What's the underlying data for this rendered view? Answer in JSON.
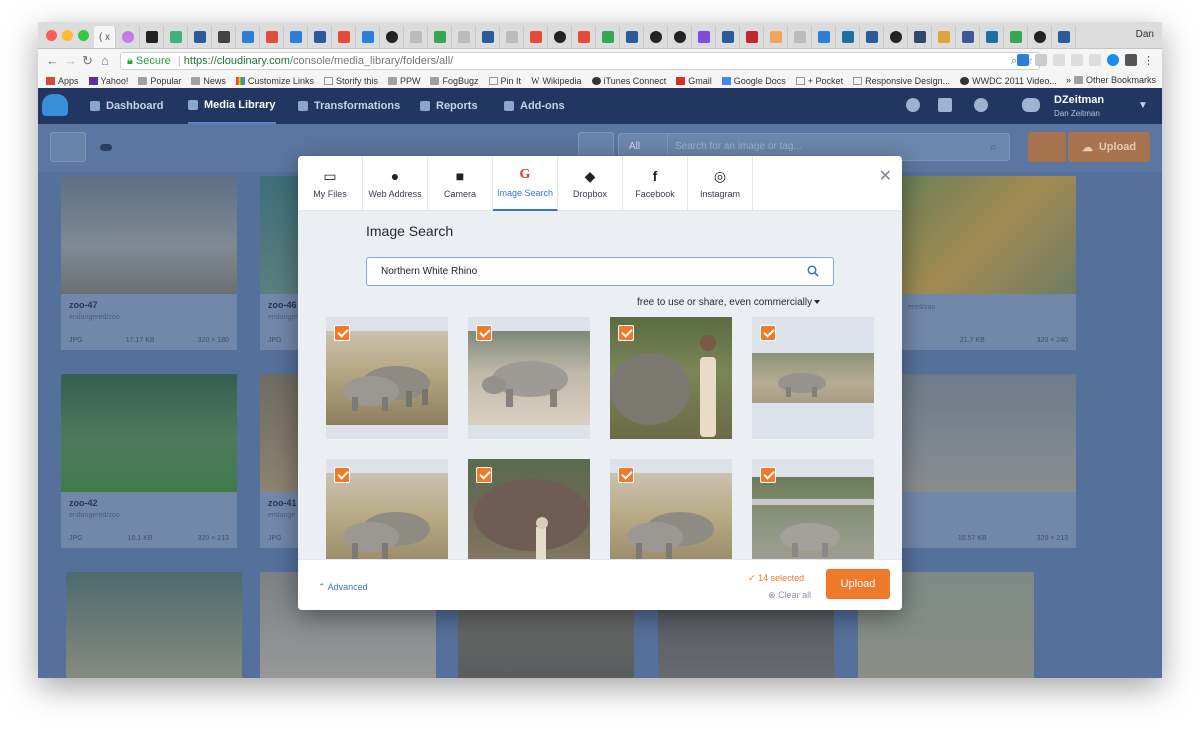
{
  "browser": {
    "profile_name": "Dan",
    "active_tab_label": "( x",
    "secure_label": "Secure",
    "url_base": "https://cloudinary.com",
    "url_path": "/console/media_library/folders/all/"
  },
  "bookmarks": {
    "items": [
      "Apps",
      "Yahoo!",
      "Popular",
      "News",
      "Customize Links",
      "Storify this",
      "PPW",
      "FogBugz",
      "Pin It",
      "Wikipedia",
      "iTunes Connect",
      "Gmail",
      "Google Docs",
      "+ Pocket",
      "Responsive Design...",
      "WWDC 2011 Video..."
    ],
    "other": "Other Bookmarks"
  },
  "app_nav": {
    "items": [
      "Dashboard",
      "Media Library",
      "Transformations",
      "Reports",
      "Add-ons"
    ],
    "active": "Media Library",
    "user_name": "DZeitman",
    "user_sub": "Dan Zeitman"
  },
  "toolbar": {
    "filter_label": "All",
    "search_placeholder": "Search for an image or tag...",
    "upload_label": "Upload"
  },
  "cards": [
    {
      "name": "zoo-47",
      "folder": "endangered/zoo",
      "format": "JPG",
      "size": "17.17 KB",
      "dims": "320 × 180"
    },
    {
      "name": "zoo-46",
      "folder": "endangered/zoo",
      "format": "JPG",
      "size": "",
      "dims": ""
    },
    {
      "name": "",
      "folder": "",
      "format": "",
      "size": "",
      "dims": ""
    },
    {
      "name": "",
      "folder": "",
      "format": "",
      "size": "",
      "dims": ""
    },
    {
      "name": "",
      "folder": "ered/zoo",
      "format": "",
      "size": "21.7 KB",
      "dims": "320 × 240"
    },
    {
      "name": "zoo-42",
      "folder": "endangered/zoo",
      "format": "JPG",
      "size": "10.1 KB",
      "dims": "320 × 213"
    },
    {
      "name": "zoo-41",
      "folder": "endange",
      "format": "JPG",
      "size": "",
      "dims": ""
    },
    {
      "name": "",
      "folder": "",
      "format": "",
      "size": "",
      "dims": ""
    },
    {
      "name": "",
      "folder": "",
      "format": "",
      "size": "",
      "dims": ""
    },
    {
      "name": "",
      "folder": "",
      "format": "",
      "size": "18.57 KB",
      "dims": "320 × 213"
    }
  ],
  "modal": {
    "tabs": [
      {
        "label": "My Files",
        "icon": "laptop-icon"
      },
      {
        "label": "Web Address",
        "icon": "globe-icon"
      },
      {
        "label": "Camera",
        "icon": "camera-icon"
      },
      {
        "label": "Image Search",
        "icon": "google-icon",
        "glyph": "G"
      },
      {
        "label": "Dropbox",
        "icon": "dropbox-icon"
      },
      {
        "label": "Facebook",
        "icon": "facebook-icon",
        "glyph": "f"
      },
      {
        "label": "Instagram",
        "icon": "instagram-icon"
      }
    ],
    "active_tab": "Image Search",
    "title": "Image Search",
    "search_value": "Northern White Rhino",
    "license_filter": "free to use or share, even commercially",
    "advanced_label": "Advanced",
    "selected_label": "14 selected",
    "clear_label": "Clear all",
    "upload_label": "Upload"
  },
  "results": [
    {
      "subject": "two rhinos grassland",
      "checked": true
    },
    {
      "subject": "rhino on sand",
      "checked": true
    },
    {
      "subject": "woman with rhino",
      "checked": true
    },
    {
      "subject": "rhino lying in enclosure",
      "checked": true
    },
    {
      "subject": "two rhinos grassland",
      "checked": true
    },
    {
      "subject": "rhino with goat",
      "checked": true
    },
    {
      "subject": "two rhinos grassland",
      "checked": true
    },
    {
      "subject": "rhino in zoo",
      "checked": true
    }
  ],
  "colors": {
    "accent": "#f07a2c",
    "link": "#3d74c7",
    "nav_bg": "#213660"
  }
}
